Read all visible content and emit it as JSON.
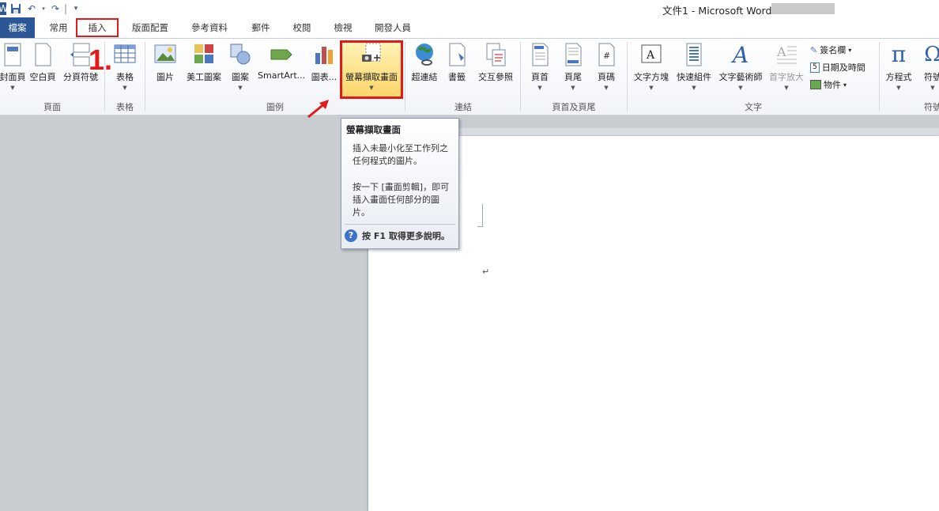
{
  "window": {
    "title": "文件1 - Microsoft Word"
  },
  "quick_access": {
    "icons": [
      "word-icon",
      "save-icon",
      "undo-icon",
      "redo-icon",
      "customize-qat-icon"
    ]
  },
  "tabs": {
    "file": "檔案",
    "items": [
      "常用",
      "插入",
      "版面配置",
      "參考資料",
      "郵件",
      "校閱",
      "檢視",
      "開發人員"
    ]
  },
  "annotation": {
    "step_number": "1."
  },
  "ribbon": {
    "pages": {
      "cover": "封面頁",
      "blank": "空白頁",
      "break": "分頁符號",
      "label": "頁面"
    },
    "table": {
      "table": "表格",
      "label": "表格"
    },
    "illustrations": {
      "picture": "圖片",
      "clipart": "美工圖案",
      "shapes": "圖案",
      "smartart": "SmartArt...",
      "chart": "圖表...",
      "screenshot": "螢幕擷取畫面",
      "label": "圖例"
    },
    "links": {
      "hyperlink": "超連結",
      "bookmark": "書籤",
      "crossref": "交互參照",
      "label": "連結"
    },
    "header_footer": {
      "header": "頁首",
      "footer": "頁尾",
      "page_number": "頁碼",
      "label": "頁首及頁尾"
    },
    "text": {
      "textbox": "文字方塊",
      "quickparts": "快速組件",
      "wordart": "文字藝術師",
      "dropcap": "首字放大",
      "signature": "簽名欄",
      "datetime": "日期及時間",
      "object": "物件",
      "label": "文字"
    },
    "symbols": {
      "equation": "方程式",
      "symbol": "符號",
      "label": "符號"
    }
  },
  "tooltip": {
    "title": "螢幕擷取畫面",
    "body1": "插入未最小化至工作列之任何程式的圖片。",
    "body2": "按一下 [畫面剪輯]，即可插入畫面任何部分的圖片。",
    "help": "按 F1 取得更多說明。"
  },
  "document": {
    "paragraph_mark": "↵"
  }
}
